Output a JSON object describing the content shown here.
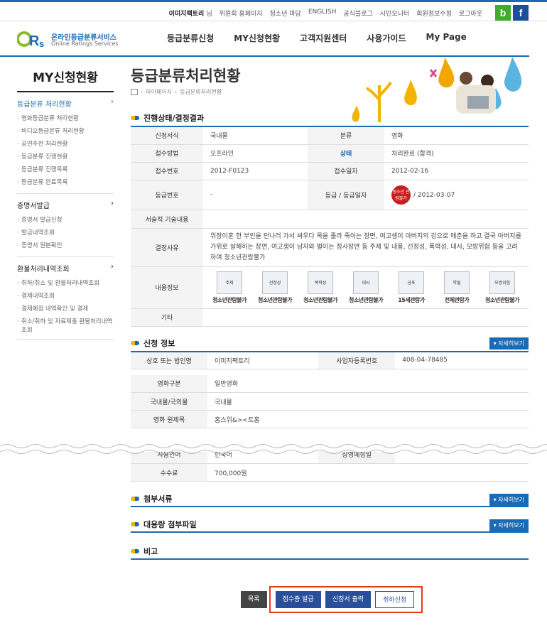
{
  "topbar": {
    "user": "이미지팩토리",
    "suffix": "님",
    "links": [
      "위원회 홈페이지",
      "청소년 마당",
      "ENGLISH",
      "공식블로그",
      "시민모니터",
      "회원정보수정",
      "로그아웃"
    ],
    "b": "b",
    "f": "f"
  },
  "logo": {
    "kr": "온라인등급분류서비스",
    "en": "Online Ratings Services"
  },
  "gnb": [
    "등급분류신청",
    "MY신청현황",
    "고객지원센터",
    "사용가이드",
    "My Page"
  ],
  "lnb": {
    "title": "MY신청현황",
    "sections": [
      {
        "head": "등급분류 처리현황",
        "items": [
          "영화등급분류 처리현황",
          "비디오등급분류 처리현황",
          "공연추천 처리현황",
          "등급분류 진행현황",
          "등급분류 진행목록",
          "등급분류 완료목록"
        ]
      },
      {
        "head": "증명서발급",
        "items": [
          "증명서 발급신청",
          "발급내역조회",
          "증명서 원본확인"
        ]
      },
      {
        "head": "환불처리내역조회",
        "items": [
          "취하/취소 및 환불처리내역조회",
          "결제내역조회",
          "결제예정 내역확인 및 결제",
          "취소/취하 및 자료제출 환불처리내역조회"
        ]
      }
    ]
  },
  "page": {
    "title": "등급분류처리현황",
    "breadcrumb": [
      "마이페이지",
      "등급분류처리현황"
    ]
  },
  "status": {
    "title": "진행상태/결정결과",
    "labels": {
      "form": "신청서식",
      "type": "분류",
      "method": "접수방법",
      "state": "상태",
      "recno": "접수번호",
      "recdate": "접수일자",
      "gradeno": "등급번호",
      "gradedate": "등급 / 등급일자",
      "desc": "서술적 기술내용",
      "reason": "결정사유",
      "content": "내용정보",
      "etc": "기타"
    },
    "values": {
      "form": "국내물",
      "type": "영화",
      "method": "오프라인",
      "state": "처리완료 (합격)",
      "recno": "2012-F0123",
      "recdate": "2012-02-16",
      "gradeno": "-",
      "stamp": "청소년 관람불가",
      "gradedate": "/ 2012-03-07",
      "desc": "",
      "reason": "위장이혼 한 부인을 만나러 가서 싸우다 목을 졸라 죽이는 장면, 여고생이 아버지의 강으로 매춘을 하고 결국 아버지를 가위로 살해하는 장면, 여고생이 남자와 벌이는 정사장면 등 주제 및 내용, 선정성, 폭력성, 대사, 모방위험 등을 고려하여 청소년관람불가",
      "etc": ""
    },
    "icons": [
      {
        "name": "주제",
        "label": "청소년관람불가"
      },
      {
        "name": "선정성",
        "label": "청소년관람불가"
      },
      {
        "name": "폭력성",
        "label": "청소년관람불가"
      },
      {
        "name": "대사",
        "label": "청소년관람불가"
      },
      {
        "name": "공포",
        "label": "15세관람가"
      },
      {
        "name": "약물",
        "label": "전체관람가"
      },
      {
        "name": "모방위험",
        "label": "청소년관람불가"
      }
    ]
  },
  "apply": {
    "title": "신청 정보",
    "more": "자세히보기",
    "labels": {
      "corp": "상호 또는 법인명",
      "bizno": "사업자등록번호",
      "genre": "영화구분",
      "origin": "국내물/국외물",
      "otitle": "영화 원제목",
      "lang": "사용언어",
      "release": "상영예정일",
      "fee": "수수료"
    },
    "values": {
      "corp": "이미지팩토리",
      "bizno": "408-04-78485",
      "genre": "일반영화",
      "origin": "국내물",
      "otitle": "홈스위&><트홈",
      "lang": "한국어",
      "release": "",
      "fee": "700,000원"
    }
  },
  "attach": {
    "title": "첨부서류",
    "more": "자세히보기"
  },
  "bigfile": {
    "title": "대용량 첨부파일",
    "more": "자세히보기"
  },
  "note": {
    "title": "비고"
  },
  "buttons": {
    "list": "목록",
    "receipt": "접수증 발급",
    "print": "신청서 출력",
    "cancel": "취하신청"
  },
  "colors": {
    "accent": "#1b6bb4",
    "yellow": "#f2b400",
    "highlight": "#e63a1e"
  }
}
